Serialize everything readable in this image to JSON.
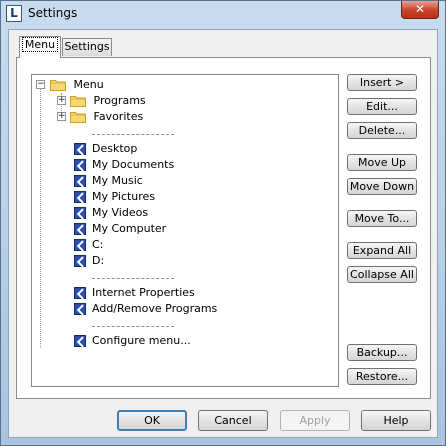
{
  "window": {
    "title": "Settings",
    "close_label": "✕",
    "app_icon_letter": "L"
  },
  "tabs": [
    {
      "label": "Menu",
      "active": true
    },
    {
      "label": "Settings",
      "active": false
    }
  ],
  "tree": {
    "root": "Menu",
    "folders": [
      "Programs",
      "Favorites"
    ],
    "group1": [
      "Desktop",
      "My Documents",
      "My Music",
      "My Pictures",
      "My Videos",
      "My Computer",
      "C:",
      "D:"
    ],
    "group2": [
      "Internet Properties",
      "Add/Remove Programs"
    ],
    "group3": [
      "Configure menu..."
    ],
    "expander_plus": "+",
    "expander_minus": "−"
  },
  "side_buttons": {
    "insert": "Insert >",
    "edit": "Edit...",
    "delete": "Delete...",
    "move_up": "Move Up",
    "move_down": "Move Down",
    "move_to": "Move To...",
    "expand_all": "Expand All",
    "collapse_all": "Collapse All",
    "backup": "Backup...",
    "restore": "Restore..."
  },
  "bottom_buttons": {
    "ok": "OK",
    "cancel": "Cancel",
    "apply": "Apply",
    "help": "Help"
  }
}
